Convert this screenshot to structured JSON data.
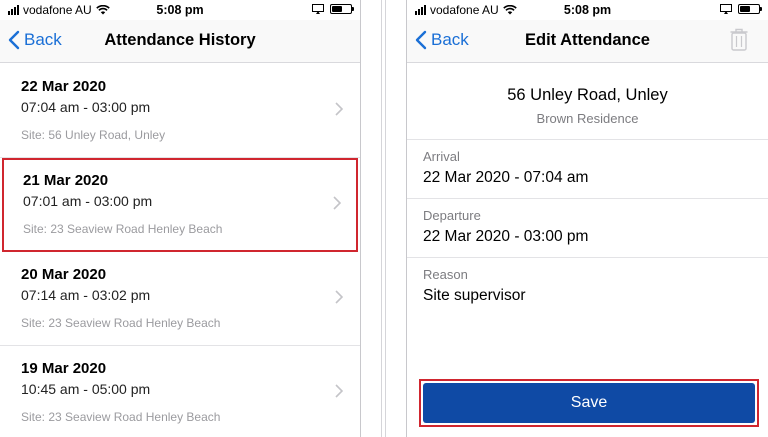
{
  "left": {
    "status": {
      "carrier": "vodafone AU",
      "time": "5:08 pm"
    },
    "nav": {
      "back": "Back",
      "title": "Attendance History"
    },
    "records": [
      {
        "date": "22 Mar 2020",
        "time_range": "07:04 am - 03:00 pm",
        "site": "Site: 56 Unley Road,  Unley",
        "selected": false
      },
      {
        "date": "21 Mar 2020",
        "time_range": "07:01 am - 03:00 pm",
        "site": "Site: 23 Seaview Road Henley Beach",
        "selected": true
      },
      {
        "date": "20 Mar 2020",
        "time_range": "07:14 am - 03:02 pm",
        "site": "Site: 23 Seaview Road Henley Beach",
        "selected": false
      },
      {
        "date": "19 Mar 2020",
        "time_range": "10:45 am - 05:00 pm",
        "site": "Site: 23 Seaview Road Henley Beach",
        "selected": false
      }
    ]
  },
  "right": {
    "status": {
      "carrier": "vodafone AU",
      "time": "5:08 pm"
    },
    "nav": {
      "back": "Back",
      "title": "Edit Attendance"
    },
    "site": {
      "address": "56 Unley Road,  Unley",
      "name": "Brown Residence"
    },
    "arrival": {
      "label": "Arrival",
      "value": "22 Mar 2020 - 07:04 am"
    },
    "departure": {
      "label": "Departure",
      "value": "22 Mar 2020 - 03:00 pm"
    },
    "reason": {
      "label": "Reason",
      "value": "Site supervisor"
    },
    "save_label": "Save"
  },
  "colors": {
    "accent": "#1a6fd6",
    "save": "#0f4aa5",
    "highlight": "#d0262f"
  },
  "icons": [
    "wifi-icon",
    "chevron-left-icon",
    "chevron-right-icon",
    "trash-icon",
    "battery-icon",
    "screen-mirror-icon"
  ]
}
